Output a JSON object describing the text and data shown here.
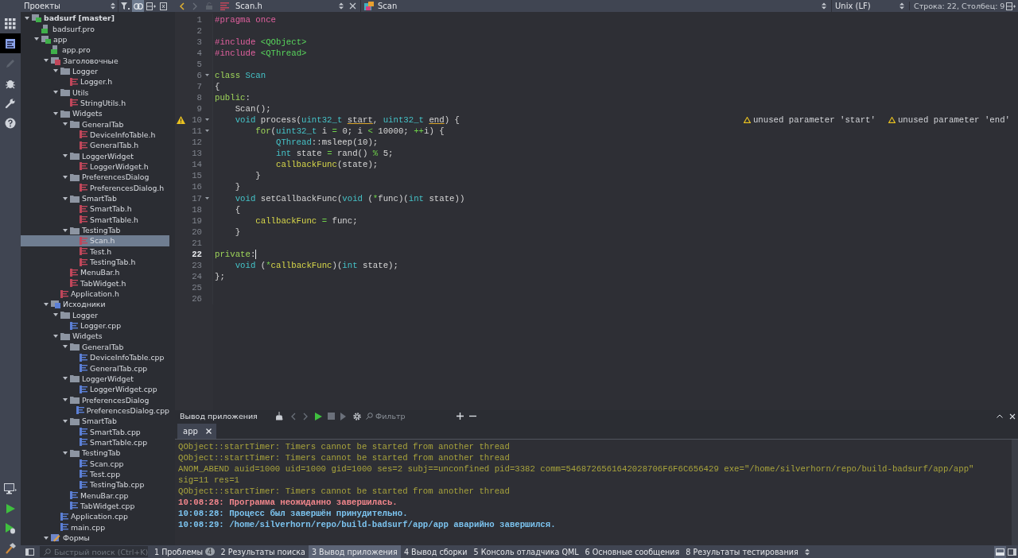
{
  "sidebar_toolbar": {
    "title": "Проекты",
    "link_with_editor": true
  },
  "editor_toolbar": {
    "file": "Scan.h",
    "symbol": "Scan",
    "line_endings": "Unix (LF)",
    "position": "Строка: 22, Столбец: 9"
  },
  "modes": [
    {
      "kind": "welcome",
      "selected": false,
      "disabled": false
    },
    {
      "kind": "edit",
      "selected": true,
      "disabled": false
    },
    {
      "kind": "design",
      "selected": false,
      "disabled": true
    },
    {
      "kind": "debug",
      "selected": false,
      "disabled": false
    },
    {
      "kind": "projects",
      "selected": false,
      "disabled": false
    },
    {
      "kind": "help",
      "selected": false,
      "disabled": false
    }
  ],
  "actions": [
    {
      "kind": "kit"
    },
    {
      "kind": "run"
    },
    {
      "kind": "debug-run"
    },
    {
      "kind": "build"
    }
  ],
  "tree": {
    "items": [
      {
        "label": "badsurf [master]",
        "kind": "project",
        "expanded": true,
        "selected": false,
        "children": [
          {
            "label": "badsurf.pro",
            "kind": "pro",
            "selected": false
          },
          {
            "label": "app",
            "kind": "project",
            "expanded": true,
            "selected": false,
            "children": [
              {
                "label": "app.pro",
                "kind": "pro",
                "selected": false
              },
              {
                "label": "Заголовочные",
                "kind": "headers",
                "expanded": true,
                "selected": false,
                "children": [
                  {
                    "label": "Logger",
                    "kind": "folder",
                    "expanded": true,
                    "selected": false,
                    "children": [
                      {
                        "label": "Logger.h",
                        "kind": "header",
                        "selected": false
                      }
                    ]
                  },
                  {
                    "label": "Utils",
                    "kind": "folder",
                    "expanded": true,
                    "selected": false,
                    "children": [
                      {
                        "label": "StringUtils.h",
                        "kind": "header",
                        "selected": false
                      }
                    ]
                  },
                  {
                    "label": "Widgets",
                    "kind": "folder",
                    "expanded": true,
                    "selected": false,
                    "children": [
                      {
                        "label": "GeneralTab",
                        "kind": "folder",
                        "expanded": true,
                        "selected": false,
                        "children": [
                          {
                            "label": "DeviceInfoTable.h",
                            "kind": "header",
                            "selected": false
                          },
                          {
                            "label": "GeneralTab.h",
                            "kind": "header",
                            "selected": false
                          }
                        ]
                      },
                      {
                        "label": "LoggerWidget",
                        "kind": "folder",
                        "expanded": true,
                        "selected": false,
                        "children": [
                          {
                            "label": "LoggerWidget.h",
                            "kind": "header",
                            "selected": false
                          }
                        ]
                      },
                      {
                        "label": "PreferencesDialog",
                        "kind": "folder",
                        "expanded": true,
                        "selected": false,
                        "children": [
                          {
                            "label": "PreferencesDialog.h",
                            "kind": "header",
                            "selected": false
                          }
                        ]
                      },
                      {
                        "label": "SmartTab",
                        "kind": "folder",
                        "expanded": true,
                        "selected": false,
                        "children": [
                          {
                            "label": "SmartTab.h",
                            "kind": "header",
                            "selected": false
                          },
                          {
                            "label": "SmartTable.h",
                            "kind": "header",
                            "selected": false
                          }
                        ]
                      },
                      {
                        "label": "TestingTab",
                        "kind": "folder",
                        "expanded": true,
                        "selected": false,
                        "children": [
                          {
                            "label": "Scan.h",
                            "kind": "header",
                            "selected": true
                          },
                          {
                            "label": "Test.h",
                            "kind": "header",
                            "selected": false
                          },
                          {
                            "label": "TestingTab.h",
                            "kind": "header",
                            "selected": false
                          }
                        ]
                      },
                      {
                        "label": "MenuBar.h",
                        "kind": "header",
                        "selected": false
                      },
                      {
                        "label": "TabWidget.h",
                        "kind": "header",
                        "selected": false
                      }
                    ]
                  },
                  {
                    "label": "Application.h",
                    "kind": "header",
                    "selected": false
                  }
                ]
              },
              {
                "label": "Исходники",
                "kind": "sources",
                "expanded": true,
                "selected": false,
                "children": [
                  {
                    "label": "Logger",
                    "kind": "folder",
                    "expanded": true,
                    "selected": false,
                    "children": [
                      {
                        "label": "Logger.cpp",
                        "kind": "source",
                        "selected": false
                      }
                    ]
                  },
                  {
                    "label": "Widgets",
                    "kind": "folder",
                    "expanded": true,
                    "selected": false,
                    "children": [
                      {
                        "label": "GeneralTab",
                        "kind": "folder",
                        "expanded": true,
                        "selected": false,
                        "children": [
                          {
                            "label": "DeviceInfoTable.cpp",
                            "kind": "source",
                            "selected": false
                          },
                          {
                            "label": "GeneralTab.cpp",
                            "kind": "source",
                            "selected": false
                          }
                        ]
                      },
                      {
                        "label": "LoggerWidget",
                        "kind": "folder",
                        "expanded": true,
                        "selected": false,
                        "children": [
                          {
                            "label": "LoggerWidget.cpp",
                            "kind": "source",
                            "selected": false
                          }
                        ]
                      },
                      {
                        "label": "PreferencesDialog",
                        "kind": "folder",
                        "expanded": true,
                        "selected": false,
                        "children": [
                          {
                            "label": "PreferencesDialog.cpp",
                            "kind": "source",
                            "selected": false
                          }
                        ]
                      },
                      {
                        "label": "SmartTab",
                        "kind": "folder",
                        "expanded": true,
                        "selected": false,
                        "children": [
                          {
                            "label": "SmartTab.cpp",
                            "kind": "source",
                            "selected": false
                          },
                          {
                            "label": "SmartTable.cpp",
                            "kind": "source",
                            "selected": false
                          }
                        ]
                      },
                      {
                        "label": "TestingTab",
                        "kind": "folder",
                        "expanded": true,
                        "selected": false,
                        "children": [
                          {
                            "label": "Scan.cpp",
                            "kind": "source",
                            "selected": false
                          },
                          {
                            "label": "Test.cpp",
                            "kind": "source",
                            "selected": false
                          },
                          {
                            "label": "TestingTab.cpp",
                            "kind": "source",
                            "selected": false
                          }
                        ]
                      },
                      {
                        "label": "MenuBar.cpp",
                        "kind": "source",
                        "selected": false
                      },
                      {
                        "label": "TabWidget.cpp",
                        "kind": "source",
                        "selected": false
                      }
                    ]
                  },
                  {
                    "label": "Application.cpp",
                    "kind": "source",
                    "selected": false
                  },
                  {
                    "label": "main.cpp",
                    "kind": "source",
                    "selected": false
                  }
                ]
              },
              {
                "label": "Формы",
                "kind": "forms",
                "expanded": true,
                "selected": false
              }
            ]
          }
        ]
      }
    ]
  },
  "code": {
    "lines": [
      {
        "number": "1",
        "fold": false,
        "warning": false,
        "current": false,
        "tokens": [
          {
            "kind": "pre",
            "text": "#pragma once"
          }
        ]
      },
      {
        "number": "2",
        "fold": false,
        "warning": false,
        "current": false
      },
      {
        "number": "3",
        "fold": false,
        "warning": false,
        "current": false,
        "tokens": [
          {
            "kind": "pre",
            "text": "#include "
          },
          {
            "kind": "include",
            "text": "<QObject>"
          }
        ]
      },
      {
        "number": "4",
        "fold": false,
        "warning": false,
        "current": false,
        "tokens": [
          {
            "kind": "pre",
            "text": "#include "
          },
          {
            "kind": "include",
            "text": "<QThread>"
          }
        ]
      },
      {
        "number": "5",
        "fold": false,
        "warning": false,
        "current": false
      },
      {
        "number": "6",
        "fold": true,
        "warning": false,
        "current": false,
        "tokens": [
          {
            "kind": "keyword",
            "text": "class "
          },
          {
            "kind": "type",
            "text": "Scan"
          }
        ]
      },
      {
        "number": "7",
        "fold": false,
        "warning": false,
        "current": false,
        "tokens": [
          {
            "kind": "plain",
            "text": "{"
          }
        ]
      },
      {
        "number": "8",
        "fold": false,
        "warning": false,
        "current": false,
        "tokens": [
          {
            "kind": "keyword",
            "text": "public"
          },
          {
            "kind": "plain",
            "text": ":"
          }
        ]
      },
      {
        "number": "9",
        "fold": false,
        "warning": false,
        "current": false,
        "tokens": [
          {
            "kind": "plain",
            "text": "    Scan();"
          }
        ]
      },
      {
        "number": "10",
        "fold": true,
        "warning": true,
        "current": false,
        "tokens": [
          {
            "kind": "type",
            "text": "    void"
          },
          {
            "kind": "plain",
            "text": " process("
          },
          {
            "kind": "type",
            "text": "uint32_t "
          },
          {
            "kind": "unused",
            "text": "start"
          },
          {
            "kind": "plain",
            "text": ", "
          },
          {
            "kind": "type",
            "text": "uint32_t "
          },
          {
            "kind": "unused",
            "text": "end"
          },
          {
            "kind": "plain",
            "text": ") {"
          }
        ],
        "annotations": [
          "unused parameter 'start'",
          "unused parameter 'end'"
        ]
      },
      {
        "number": "11",
        "fold": true,
        "warning": false,
        "current": false,
        "tokens": [
          {
            "kind": "keyword",
            "text": "        for"
          },
          {
            "kind": "plain",
            "text": "("
          },
          {
            "kind": "type",
            "text": "uint32_t"
          },
          {
            "kind": "plain",
            "text": " i "
          },
          {
            "kind": "op",
            "text": "="
          },
          {
            "kind": "plain",
            "text": " 0; i "
          },
          {
            "kind": "op",
            "text": "<"
          },
          {
            "kind": "plain",
            "text": " 10000; "
          },
          {
            "kind": "op",
            "text": "++"
          },
          {
            "kind": "plain",
            "text": "i) {"
          }
        ]
      },
      {
        "number": "12",
        "fold": false,
        "warning": false,
        "current": false,
        "tokens": [
          {
            "kind": "type",
            "text": "            QThread"
          },
          {
            "kind": "plain",
            "text": "::msleep(10);"
          }
        ]
      },
      {
        "number": "13",
        "fold": false,
        "warning": false,
        "current": false,
        "tokens": [
          {
            "kind": "type",
            "text": "            int"
          },
          {
            "kind": "plain",
            "text": " state "
          },
          {
            "kind": "op",
            "text": "="
          },
          {
            "kind": "plain",
            "text": " rand() "
          },
          {
            "kind": "op",
            "text": "%"
          },
          {
            "kind": "plain",
            "text": " 5;"
          }
        ]
      },
      {
        "number": "14",
        "fold": false,
        "warning": false,
        "current": false,
        "tokens": [
          {
            "kind": "func",
            "text": "            callbackFunc"
          },
          {
            "kind": "plain",
            "text": "(state);"
          }
        ]
      },
      {
        "number": "15",
        "fold": false,
        "warning": false,
        "current": false,
        "tokens": [
          {
            "kind": "plain",
            "text": "        }"
          }
        ]
      },
      {
        "number": "16",
        "fold": false,
        "warning": false,
        "current": false,
        "tokens": [
          {
            "kind": "plain",
            "text": "    }"
          }
        ]
      },
      {
        "number": "17",
        "fold": true,
        "warning": false,
        "current": false,
        "tokens": [
          {
            "kind": "type",
            "text": "    void"
          },
          {
            "kind": "plain",
            "text": " setCallbackFunc("
          },
          {
            "kind": "type",
            "text": "void"
          },
          {
            "kind": "plain",
            "text": " ("
          },
          {
            "kind": "op",
            "text": "*"
          },
          {
            "kind": "plain",
            "text": "func)("
          },
          {
            "kind": "type",
            "text": "int"
          },
          {
            "kind": "plain",
            "text": " state))"
          }
        ]
      },
      {
        "number": "18",
        "fold": false,
        "warning": false,
        "current": false,
        "tokens": [
          {
            "kind": "plain",
            "text": "    {"
          }
        ]
      },
      {
        "number": "19",
        "fold": false,
        "warning": false,
        "current": false,
        "tokens": [
          {
            "kind": "func",
            "text": "        callbackFunc "
          },
          {
            "kind": "op",
            "text": "="
          },
          {
            "kind": "plain",
            "text": " func;"
          }
        ]
      },
      {
        "number": "20",
        "fold": false,
        "warning": false,
        "current": false,
        "tokens": [
          {
            "kind": "plain",
            "text": "    }"
          }
        ]
      },
      {
        "number": "21",
        "fold": false,
        "warning": false,
        "current": false
      },
      {
        "number": "22",
        "fold": false,
        "warning": false,
        "current": true,
        "tokens": [
          {
            "kind": "keyword",
            "text": "private"
          },
          {
            "kind": "plain",
            "text": ":"
          }
        ]
      },
      {
        "number": "23",
        "fold": false,
        "warning": false,
        "current": false,
        "tokens": [
          {
            "kind": "type",
            "text": "    void"
          },
          {
            "kind": "plain",
            "text": " ("
          },
          {
            "kind": "op",
            "text": "*"
          },
          {
            "kind": "func",
            "text": "callbackFunc"
          },
          {
            "kind": "plain",
            "text": ")("
          },
          {
            "kind": "type",
            "text": "int"
          },
          {
            "kind": "plain",
            "text": " state);"
          }
        ]
      },
      {
        "number": "24",
        "fold": false,
        "warning": false,
        "current": false,
        "tokens": [
          {
            "kind": "plain",
            "text": "};"
          }
        ]
      },
      {
        "number": "25",
        "fold": false,
        "warning": false,
        "current": false
      },
      {
        "number": "26",
        "fold": false,
        "warning": false,
        "current": false
      }
    ]
  },
  "output": {
    "title": "Вывод приложения",
    "filter_placeholder": "Фильтр",
    "tabs": [
      {
        "label": "app",
        "selected": true
      }
    ],
    "lines": [
      {
        "kind": "warning",
        "text": "QObject::startTimer: Timers cannot be started from another thread"
      },
      {
        "kind": "warning",
        "text": "QObject::startTimer: Timers cannot be started from another thread"
      },
      {
        "kind": "warning",
        "text": "ANOM_ABEND auid=1000 uid=1000 gid=1000 ses=2 subj==unconfined pid=3382 comm=5468726561642028706F6F6C656429 exe=\"/home/silverhorn/repo/build-badsurf/app/app\""
      },
      {
        "kind": "warning",
        "text": "sig=11 res=1"
      },
      {
        "kind": "warning",
        "text": "QObject::startTimer: Timers cannot be started from another thread"
      },
      {
        "kind": "error",
        "text": "10:08:28: Программа неожиданно завершилась."
      },
      {
        "kind": "info",
        "text": "10:08:28: Процесс был завершён принудительно."
      },
      {
        "kind": "info",
        "text": "10:08:29: /home/silverhorn/repo/build-badsurf/app/app аварийно завершился."
      }
    ]
  },
  "status_bar": {
    "search_placeholder": "Быстрый поиск (Ctrl+K)",
    "panes": [
      {
        "number": "1",
        "label": "Проблемы",
        "badge": "4",
        "selected": false
      },
      {
        "number": "2",
        "label": "Результаты поиска",
        "selected": false
      },
      {
        "number": "3",
        "label": "Вывод приложения",
        "selected": true
      },
      {
        "number": "4",
        "label": "Вывод сборки",
        "selected": false
      },
      {
        "number": "5",
        "label": "Консоль отладчика QML",
        "selected": false
      },
      {
        "number": "6",
        "label": "Основные сообщения",
        "selected": false
      },
      {
        "number": "8",
        "label": "Результаты тестирования",
        "selected": false
      }
    ]
  }
}
